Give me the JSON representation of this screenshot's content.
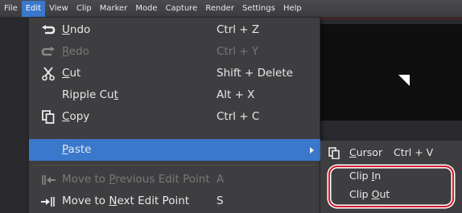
{
  "menubar": {
    "items": [
      "File",
      "Edit",
      "View",
      "Clip",
      "Marker",
      "Mode",
      "Capture",
      "Render",
      "Settings",
      "Help"
    ],
    "active_index": 1
  },
  "edit_menu": {
    "items": [
      {
        "pre": "",
        "key": "U",
        "post": "ndo",
        "shortcut": "Ctrl + Z",
        "icon": "undo-icon",
        "enabled": true
      },
      {
        "pre": "",
        "key": "R",
        "post": "edo",
        "shortcut": "Ctrl + Y",
        "icon": "redo-icon",
        "enabled": false
      },
      {
        "pre": "",
        "key": "C",
        "post": "ut",
        "shortcut": "Shift + Delete",
        "icon": "scissors-icon",
        "enabled": true
      },
      {
        "pre": "Ripple Cu",
        "key": "t",
        "post": "",
        "shortcut": "Alt + X",
        "icon": "",
        "enabled": true
      },
      {
        "pre": "",
        "key": "C",
        "post": "opy",
        "shortcut": "Ctrl + C",
        "icon": "copy-icon",
        "enabled": true
      },
      {
        "pre": "",
        "key": "P",
        "post": "aste",
        "shortcut": "",
        "icon": "",
        "enabled": true,
        "highlighted": true,
        "has_submenu": true
      },
      {
        "pre": "Move to ",
        "key": "P",
        "post": "revious Edit Point",
        "shortcut": "A",
        "icon": "previous-edit-point-icon",
        "enabled": false
      },
      {
        "pre": "Move to ",
        "key": "N",
        "post": "ext Edit Point",
        "shortcut": "S",
        "icon": "next-edit-point-icon",
        "enabled": true
      }
    ]
  },
  "paste_submenu": {
    "items": [
      {
        "pre": "",
        "key": "C",
        "post": "ursor",
        "shortcut": "Ctrl + V",
        "icon": "paste-cursor-icon"
      },
      {
        "pre": "Clip ",
        "key": "I",
        "post": "n",
        "shortcut": ""
      },
      {
        "pre": "Clip ",
        "key": "O",
        "post": "ut",
        "shortcut": ""
      }
    ]
  },
  "colors": {
    "menu_bg": "#3e3e41",
    "highlight": "#3a78cc",
    "disabled_text": "#787878",
    "callout_red": "#d41c2c"
  }
}
